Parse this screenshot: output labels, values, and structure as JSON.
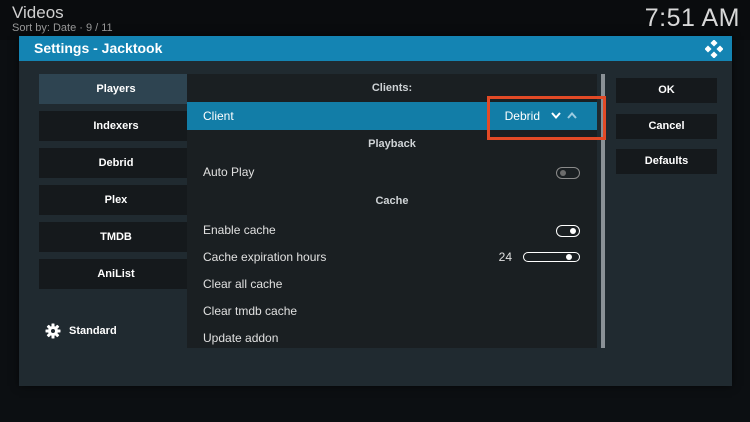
{
  "background": {
    "window_title": "Videos",
    "sort_info": "Sort by: Date  ·  9 / 11",
    "clock": "7:51 AM"
  },
  "dialog": {
    "title": "Settings - Jacktook",
    "categories": [
      {
        "label": "Players",
        "active": true
      },
      {
        "label": "Indexers"
      },
      {
        "label": "Debrid"
      },
      {
        "label": "Plex"
      },
      {
        "label": "TMDB"
      },
      {
        "label": "AniList"
      }
    ],
    "level_label": "Standard",
    "sections": {
      "clients": "Clients:",
      "playback": "Playback",
      "cache": "Cache"
    },
    "settings": {
      "client": {
        "label": "Client",
        "value": "Debrid"
      },
      "auto_play": {
        "label": "Auto Play",
        "enabled": false
      },
      "enable_cache": {
        "label": "Enable cache",
        "enabled": true
      },
      "cache_expiration": {
        "label": "Cache expiration hours",
        "value": "24"
      },
      "clear_all_cache": {
        "label": "Clear all cache"
      },
      "clear_tmdb_cache": {
        "label": "Clear tmdb cache"
      },
      "update_addon": {
        "label": "Update addon"
      }
    },
    "buttons": {
      "ok": "OK",
      "cancel": "Cancel",
      "defaults": "Defaults"
    }
  },
  "colors": {
    "accent": "#1484b3",
    "focus": "#127da7",
    "annotation": "#e24a26"
  }
}
